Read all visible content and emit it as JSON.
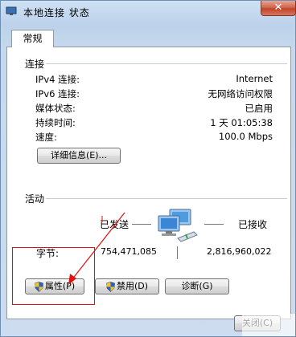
{
  "window": {
    "title": "本地连接 状态",
    "close_label": "✕"
  },
  "tabs": [
    {
      "label": "常规"
    }
  ],
  "connection": {
    "heading": "连接",
    "rows": [
      {
        "label": "IPv4 连接:",
        "value": "Internet"
      },
      {
        "label": "IPv6 连接:",
        "value": "无网络访问权限"
      },
      {
        "label": "媒体状态:",
        "value": "已启用"
      },
      {
        "label": "持续时间:",
        "value": "1 天 01:05:38"
      },
      {
        "label": "速度:",
        "value": "100.0 Mbps"
      }
    ],
    "details_button": "详细信息(E)..."
  },
  "activity": {
    "heading": "活动",
    "sent_label": "已发送",
    "received_label": "已接收",
    "bytes_label": "字节:",
    "bytes_sent": "754,471,085",
    "bytes_received": "2,816,960,022"
  },
  "buttons": {
    "properties": "属性(P)",
    "disable": "禁用(D)",
    "diagnose": "诊断(G)",
    "close": "关闭(C)"
  },
  "colors": {
    "annotation_red": "#e01010",
    "close_button": "#c1442a",
    "shield_blue": "#2f63b8",
    "shield_yellow": "#f2c12e"
  }
}
